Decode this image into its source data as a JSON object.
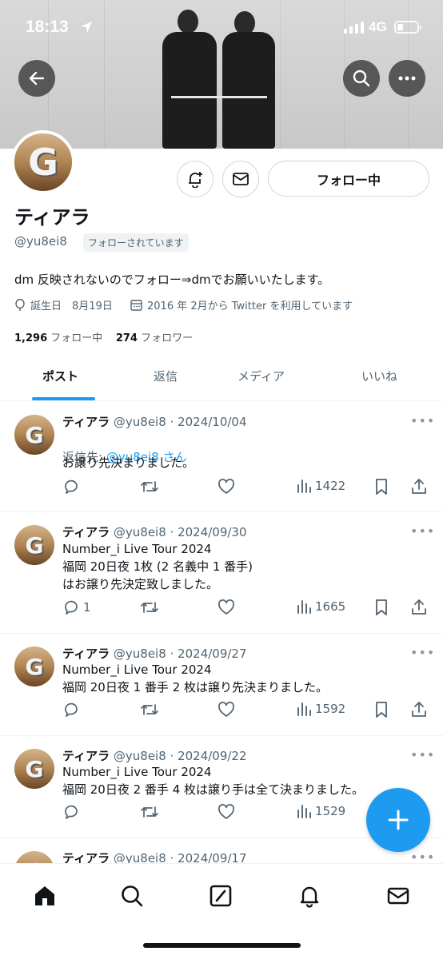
{
  "status_bar": {
    "time": "18:13",
    "network": "4G",
    "battery_level": 0.3
  },
  "profile": {
    "avatar_letter": "G",
    "name": "ティアラ",
    "handle": "@yu8ei8",
    "follows_you": "フォローされています",
    "bio": "dm 反映されないのでフォロー⇒dmでお願いいたします。",
    "birthday": "誕生日　8月19日",
    "joined": "2016 年 2月から Twitter を利用しています",
    "following_count": "1,296",
    "following_label": "フォロー中",
    "followers_count": "274",
    "followers_label": "フォロワー",
    "follow_button": "フォロー中"
  },
  "tabs": [
    "ポスト",
    "返信",
    "メディア",
    "いいね"
  ],
  "posts": [
    {
      "name": "ティアラ",
      "meta": "@yu8ei8 · 2024/10/04",
      "reply_prefix": "返信先: ",
      "reply_to": "@yu8ei8 さん",
      "text": "お譲り先決まりました。",
      "replies": "",
      "views": "1422"
    },
    {
      "name": "ティアラ",
      "meta": "@yu8ei8 · 2024/09/30",
      "text": "Number_i Live Tour 2024\n福岡 20日夜 1枚 (2 名義中 1 番手)\nはお譲り先決定致しました。",
      "replies": "1",
      "views": "1665"
    },
    {
      "name": "ティアラ",
      "meta": "@yu8ei8 · 2024/09/27",
      "text": "Number_i Live Tour 2024\n福岡 20日夜 1 番手 2 枚は譲り先決まりました。",
      "replies": "",
      "views": "1592"
    },
    {
      "name": "ティアラ",
      "meta": "@yu8ei8 · 2024/09/22",
      "text": "Number_i Live Tour 2024\n福岡 20日夜 2 番手 4 枚は譲り手は全て決まりました。",
      "replies": "",
      "views": "1529"
    },
    {
      "name": "ティアラ",
      "meta": "@yu8ei8 · 2024/09/17"
    }
  ],
  "icons": {
    "back": "back-arrow-icon",
    "search": "search-icon",
    "more": "more-icon",
    "notify": "bell-plus-icon",
    "message": "envelope-icon",
    "compose": "plus-icon",
    "nav": [
      "home-icon",
      "search-icon",
      "compose-icon",
      "bell-icon",
      "envelope-icon"
    ]
  },
  "colors": {
    "accent": "#1d9bf0",
    "text": "#0f1419",
    "muted": "#536471"
  }
}
